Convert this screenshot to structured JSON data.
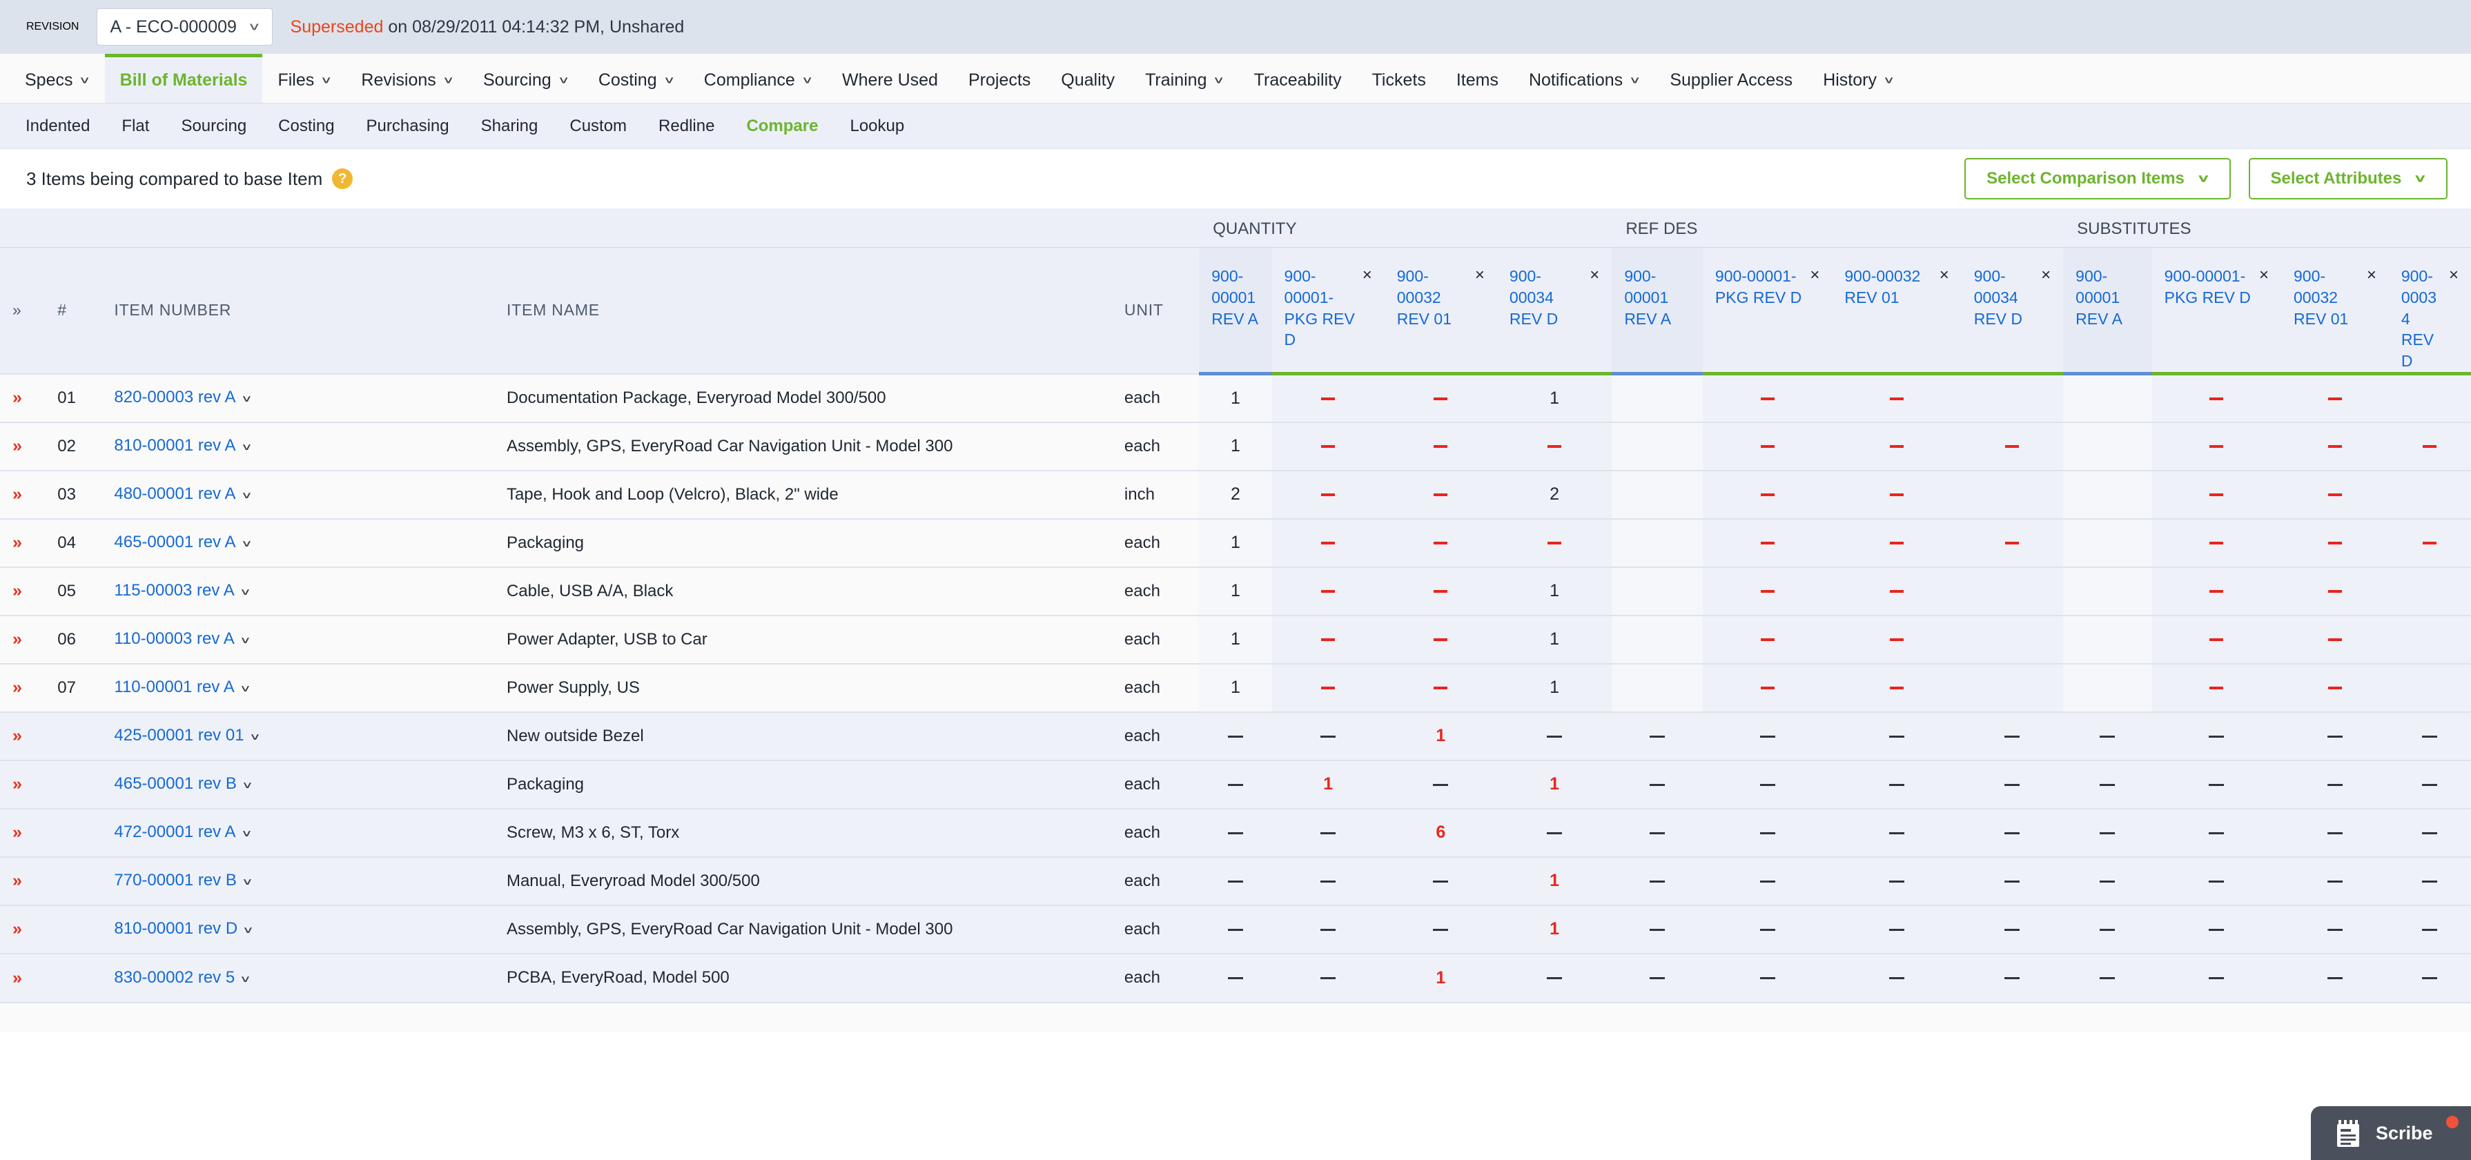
{
  "revision": {
    "label": "REVISION",
    "selected": "A - ECO-000009",
    "status_prefix": "Superseded",
    "status_rest": " on 08/29/2011 04:14:32 PM, Unshared",
    "chevron_icon": "chevron-down-icon"
  },
  "main_tabs": [
    {
      "label": "Specs",
      "caret": true,
      "active": false
    },
    {
      "label": "Bill of Materials",
      "caret": false,
      "active": true
    },
    {
      "label": "Files",
      "caret": true,
      "active": false
    },
    {
      "label": "Revisions",
      "caret": true,
      "active": false
    },
    {
      "label": "Sourcing",
      "caret": true,
      "active": false
    },
    {
      "label": "Costing",
      "caret": true,
      "active": false
    },
    {
      "label": "Compliance",
      "caret": true,
      "active": false
    },
    {
      "label": "Where Used",
      "caret": false,
      "active": false
    },
    {
      "label": "Projects",
      "caret": false,
      "active": false
    },
    {
      "label": "Quality",
      "caret": false,
      "active": false
    },
    {
      "label": "Training",
      "caret": true,
      "active": false
    },
    {
      "label": "Traceability",
      "caret": false,
      "active": false
    },
    {
      "label": "Tickets",
      "caret": false,
      "active": false
    },
    {
      "label": "Items",
      "caret": false,
      "active": false
    },
    {
      "label": "Notifications",
      "caret": true,
      "active": false
    },
    {
      "label": "Supplier Access",
      "caret": false,
      "active": false
    },
    {
      "label": "History",
      "caret": true,
      "active": false
    }
  ],
  "sub_tabs": [
    {
      "label": "Indented",
      "active": false
    },
    {
      "label": "Flat",
      "active": false
    },
    {
      "label": "Sourcing",
      "active": false
    },
    {
      "label": "Costing",
      "active": false
    },
    {
      "label": "Purchasing",
      "active": false
    },
    {
      "label": "Sharing",
      "active": false
    },
    {
      "label": "Custom",
      "active": false
    },
    {
      "label": "Redline",
      "active": false
    },
    {
      "label": "Compare",
      "active": true
    },
    {
      "label": "Lookup",
      "active": false
    }
  ],
  "toolbar": {
    "compare_note": "3 Items being compared to base Item",
    "help_glyph": "?",
    "select_comparison_items": "Select Comparison Items",
    "select_attributes": "Select Attributes",
    "caret_glyph": "∨"
  },
  "table": {
    "groups": [
      {
        "label": "QUANTITY"
      },
      {
        "label": "REF DES"
      },
      {
        "label": "SUBSTITUTES"
      }
    ],
    "left_headers": {
      "expand": "»",
      "number": "#",
      "item_number": "ITEM NUMBER",
      "item_name": "ITEM NAME",
      "unit": "UNIT"
    },
    "comparison_columns": [
      {
        "label": "900-00001 REV A",
        "base": true,
        "closable": false
      },
      {
        "label": "900-00001-PKG REV D",
        "base": false,
        "closable": true
      },
      {
        "label": "900-00032 REV 01",
        "base": false,
        "closable": true
      },
      {
        "label": "900-00034 REV D",
        "base": false,
        "closable": true
      }
    ],
    "close_glyph": "×",
    "rows": [
      {
        "num": "01",
        "item": "820-00003 rev A",
        "name": "Documentation Package, Everyroad Model 300/500",
        "unit": "each",
        "alt": false,
        "quantity": [
          "1",
          "dash-red",
          "dash-red",
          "1"
        ],
        "refdes": [
          "",
          "dash-red",
          "dash-red",
          ""
        ],
        "substitutes": [
          "",
          "dash-red",
          "dash-red",
          ""
        ]
      },
      {
        "num": "02",
        "item": "810-00001 rev A",
        "name": "Assembly, GPS, EveryRoad Car Navigation Unit - Model 300",
        "unit": "each",
        "alt": false,
        "quantity": [
          "1",
          "dash-red",
          "dash-red",
          "dash-red"
        ],
        "refdes": [
          "",
          "dash-red",
          "dash-red",
          "dash-red"
        ],
        "substitutes": [
          "",
          "dash-red",
          "dash-red",
          "dash-red"
        ]
      },
      {
        "num": "03",
        "item": "480-00001 rev A",
        "name": "Tape, Hook and Loop (Velcro), Black, 2\" wide",
        "unit": "inch",
        "alt": false,
        "quantity": [
          "2",
          "dash-red",
          "dash-red",
          "2"
        ],
        "refdes": [
          "",
          "dash-red",
          "dash-red",
          ""
        ],
        "substitutes": [
          "",
          "dash-red",
          "dash-red",
          ""
        ]
      },
      {
        "num": "04",
        "item": "465-00001 rev A",
        "name": "Packaging",
        "unit": "each",
        "alt": false,
        "quantity": [
          "1",
          "dash-red",
          "dash-red",
          "dash-red"
        ],
        "refdes": [
          "",
          "dash-red",
          "dash-red",
          "dash-red"
        ],
        "substitutes": [
          "",
          "dash-red",
          "dash-red",
          "dash-red"
        ]
      },
      {
        "num": "05",
        "item": "115-00003 rev A",
        "name": "Cable, USB A/A, Black",
        "unit": "each",
        "alt": false,
        "quantity": [
          "1",
          "dash-red",
          "dash-red",
          "1"
        ],
        "refdes": [
          "",
          "dash-red",
          "dash-red",
          ""
        ],
        "substitutes": [
          "",
          "dash-red",
          "dash-red",
          ""
        ]
      },
      {
        "num": "06",
        "item": "110-00003 rev A",
        "name": "Power Adapter, USB to Car",
        "unit": "each",
        "alt": false,
        "quantity": [
          "1",
          "dash-red",
          "dash-red",
          "1"
        ],
        "refdes": [
          "",
          "dash-red",
          "dash-red",
          ""
        ],
        "substitutes": [
          "",
          "dash-red",
          "dash-red",
          ""
        ]
      },
      {
        "num": "07",
        "item": "110-00001 rev A",
        "name": "Power Supply, US",
        "unit": "each",
        "alt": false,
        "quantity": [
          "1",
          "dash-red",
          "dash-red",
          "1"
        ],
        "refdes": [
          "",
          "dash-red",
          "dash-red",
          ""
        ],
        "substitutes": [
          "",
          "dash-red",
          "dash-red",
          ""
        ]
      },
      {
        "num": "",
        "item": "425-00001 rev 01",
        "name": "New outside Bezel",
        "unit": "each",
        "alt": true,
        "quantity": [
          "dash-dark",
          "dash-dark",
          "red:1",
          "dash-dark"
        ],
        "refdes": [
          "dash-dark",
          "dash-dark",
          "dash-dark",
          "dash-dark"
        ],
        "substitutes": [
          "dash-dark",
          "dash-dark",
          "dash-dark",
          "dash-dark"
        ]
      },
      {
        "num": "",
        "item": "465-00001 rev B",
        "name": "Packaging",
        "unit": "each",
        "alt": true,
        "quantity": [
          "dash-dark",
          "red:1",
          "dash-dark",
          "red:1"
        ],
        "refdes": [
          "dash-dark",
          "dash-dark",
          "dash-dark",
          "dash-dark"
        ],
        "substitutes": [
          "dash-dark",
          "dash-dark",
          "dash-dark",
          "dash-dark"
        ]
      },
      {
        "num": "",
        "item": "472-00001 rev A",
        "name": "Screw, M3 x 6, ST, Torx",
        "unit": "each",
        "alt": true,
        "quantity": [
          "dash-dark",
          "dash-dark",
          "red:6",
          "dash-dark"
        ],
        "refdes": [
          "dash-dark",
          "dash-dark",
          "dash-dark",
          "dash-dark"
        ],
        "substitutes": [
          "dash-dark",
          "dash-dark",
          "dash-dark",
          "dash-dark"
        ]
      },
      {
        "num": "",
        "item": "770-00001 rev B",
        "name": "Manual, Everyroad Model 300/500",
        "unit": "each",
        "alt": true,
        "quantity": [
          "dash-dark",
          "dash-dark",
          "dash-dark",
          "red:1"
        ],
        "refdes": [
          "dash-dark",
          "dash-dark",
          "dash-dark",
          "dash-dark"
        ],
        "substitutes": [
          "dash-dark",
          "dash-dark",
          "dash-dark",
          "dash-dark"
        ]
      },
      {
        "num": "",
        "item": "810-00001 rev D",
        "name": "Assembly, GPS, EveryRoad Car Navigation Unit - Model 300",
        "unit": "each",
        "alt": true,
        "quantity": [
          "dash-dark",
          "dash-dark",
          "dash-dark",
          "red:1"
        ],
        "refdes": [
          "dash-dark",
          "dash-dark",
          "dash-dark",
          "dash-dark"
        ],
        "substitutes": [
          "dash-dark",
          "dash-dark",
          "dash-dark",
          "dash-dark"
        ]
      },
      {
        "num": "",
        "item": "830-00002 rev 5",
        "name": "PCBA, EveryRoad, Model 500",
        "unit": "each",
        "alt": true,
        "quantity": [
          "dash-dark",
          "dash-dark",
          "red:1",
          "dash-dark"
        ],
        "refdes": [
          "dash-dark",
          "dash-dark",
          "dash-dark",
          "dash-dark"
        ],
        "substitutes": [
          "dash-dark",
          "dash-dark",
          "dash-dark",
          "dash-dark"
        ]
      }
    ],
    "row_expand_glyph": "»",
    "row_caret_glyph": "∨"
  },
  "scribe": {
    "label": "Scribe",
    "icon": "notepad-icon",
    "badge": "notification-dot"
  },
  "colors": {
    "accent_green": "#6cb52d",
    "link_blue": "#1569d6",
    "diff_red": "#e8251f",
    "base_blue": "#5b8fd4",
    "header_bg": "#eceff8"
  }
}
